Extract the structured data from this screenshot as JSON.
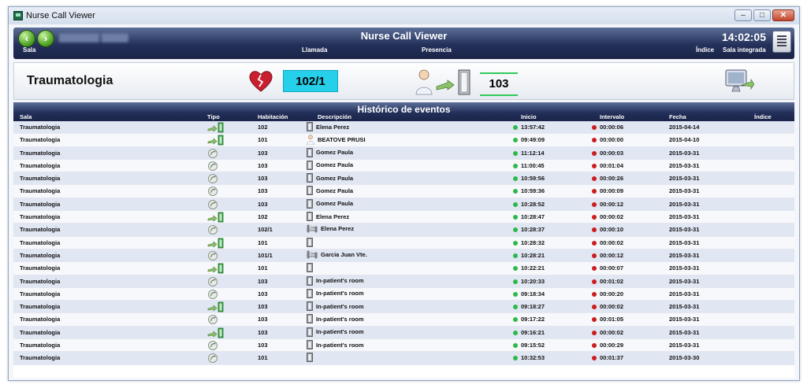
{
  "window": {
    "title": "Nurse Call Viewer"
  },
  "header": {
    "title": "Nurse Call Viewer",
    "time": "14:02:05",
    "labels": {
      "sala": "Sala",
      "llamada": "Llamada",
      "presencia": "Presencia",
      "indice": "Índice",
      "sala_integrada": "Sala integrada"
    }
  },
  "summary": {
    "sala": "Traumatologia",
    "llamada": "102/1",
    "presencia": "103"
  },
  "history": {
    "title": "Histórico de eventos",
    "columns": {
      "sala": "Sala",
      "tipo": "Tipo",
      "habitacion": "Habitación",
      "descripcion": "Descripción",
      "inicio": "Inicio",
      "intervalo": "Intervalo",
      "fecha": "Fecha",
      "indice": "Índice"
    },
    "rows": [
      {
        "sala": "Traumatologia",
        "tipo": "presence",
        "hab": "102",
        "desc_icon": "door",
        "desc": "Elena Perez",
        "inicio": "13:57:42",
        "intervalo": "00:00:06",
        "fecha": "2015-04-14"
      },
      {
        "sala": "Traumatologia",
        "tipo": "presence",
        "hab": "101",
        "desc_icon": "nurse",
        "desc": "BEATOVE PRUSI",
        "inicio": "09:49:09",
        "intervalo": "00:00:00",
        "fecha": "2015-04-10"
      },
      {
        "sala": "Traumatologia",
        "tipo": "call",
        "hab": "103",
        "desc_icon": "door",
        "desc": "Gomez Paula",
        "inicio": "11:12:14",
        "intervalo": "00:00:03",
        "fecha": "2015-03-31"
      },
      {
        "sala": "Traumatologia",
        "tipo": "call",
        "hab": "103",
        "desc_icon": "door",
        "desc": "Gomez Paula",
        "inicio": "11:00:45",
        "intervalo": "00:01:04",
        "fecha": "2015-03-31"
      },
      {
        "sala": "Traumatologia",
        "tipo": "call",
        "hab": "103",
        "desc_icon": "door",
        "desc": "Gomez Paula",
        "inicio": "10:59:56",
        "intervalo": "00:00:26",
        "fecha": "2015-03-31"
      },
      {
        "sala": "Traumatologia",
        "tipo": "call",
        "hab": "103",
        "desc_icon": "door",
        "desc": "Gomez Paula",
        "inicio": "10:59:36",
        "intervalo": "00:00:09",
        "fecha": "2015-03-31"
      },
      {
        "sala": "Traumatologia",
        "tipo": "call",
        "hab": "103",
        "desc_icon": "door",
        "desc": "Gomez Paula",
        "inicio": "10:28:52",
        "intervalo": "00:00:12",
        "fecha": "2015-03-31"
      },
      {
        "sala": "Traumatologia",
        "tipo": "presence",
        "hab": "102",
        "desc_icon": "door",
        "desc": "Elena Perez",
        "inicio": "10:28:47",
        "intervalo": "00:00:02",
        "fecha": "2015-03-31"
      },
      {
        "sala": "Traumatologia",
        "tipo": "call",
        "hab": "102/1",
        "desc_icon": "bed",
        "desc": "Elena Perez",
        "inicio": "10:28:37",
        "intervalo": "00:00:10",
        "fecha": "2015-03-31"
      },
      {
        "sala": "Traumatologia",
        "tipo": "presence",
        "hab": "101",
        "desc_icon": "door",
        "desc": "",
        "inicio": "10:28:32",
        "intervalo": "00:00:02",
        "fecha": "2015-03-31"
      },
      {
        "sala": "Traumatologia",
        "tipo": "call",
        "hab": "101/1",
        "desc_icon": "bed",
        "desc": "Garcia Juan Vte.",
        "inicio": "10:28:21",
        "intervalo": "00:00:12",
        "fecha": "2015-03-31"
      },
      {
        "sala": "Traumatologia",
        "tipo": "presence",
        "hab": "101",
        "desc_icon": "door",
        "desc": "",
        "inicio": "10:22:21",
        "intervalo": "00:00:07",
        "fecha": "2015-03-31"
      },
      {
        "sala": "Traumatologia",
        "tipo": "call",
        "hab": "103",
        "desc_icon": "door",
        "desc": "In-patient's room",
        "inicio": "10:20:33",
        "intervalo": "00:01:02",
        "fecha": "2015-03-31"
      },
      {
        "sala": "Traumatologia",
        "tipo": "call",
        "hab": "103",
        "desc_icon": "door",
        "desc": "In-patient's room",
        "inicio": "09:18:34",
        "intervalo": "00:00:20",
        "fecha": "2015-03-31"
      },
      {
        "sala": "Traumatologia",
        "tipo": "presence",
        "hab": "103",
        "desc_icon": "door",
        "desc": "In-patient's room",
        "inicio": "09:18:27",
        "intervalo": "00:00:02",
        "fecha": "2015-03-31"
      },
      {
        "sala": "Traumatologia",
        "tipo": "call",
        "hab": "103",
        "desc_icon": "door",
        "desc": "In-patient's room",
        "inicio": "09:17:22",
        "intervalo": "00:01:05",
        "fecha": "2015-03-31"
      },
      {
        "sala": "Traumatologia",
        "tipo": "presence",
        "hab": "103",
        "desc_icon": "door",
        "desc": "In-patient's room",
        "inicio": "09:16:21",
        "intervalo": "00:00:02",
        "fecha": "2015-03-31"
      },
      {
        "sala": "Traumatologia",
        "tipo": "call",
        "hab": "103",
        "desc_icon": "door",
        "desc": "In-patient's room",
        "inicio": "09:15:52",
        "intervalo": "00:00:29",
        "fecha": "2015-03-31"
      },
      {
        "sala": "Traumatologia",
        "tipo": "call",
        "hab": "101",
        "desc_icon": "door",
        "desc": "",
        "inicio": "10:32:53",
        "intervalo": "00:01:37",
        "fecha": "2015-03-30"
      }
    ]
  },
  "colors": {
    "header_top": "#5c6f98",
    "header_bottom": "#1b2448",
    "row_odd": "#e1e6f3",
    "row_even": "#f7f8fb",
    "llamada_badge": "#27d0ea",
    "presencia_line": "#2fc95a",
    "inicio_dot": "#2eb84a",
    "intervalo_dot": "#cc1d1d"
  }
}
